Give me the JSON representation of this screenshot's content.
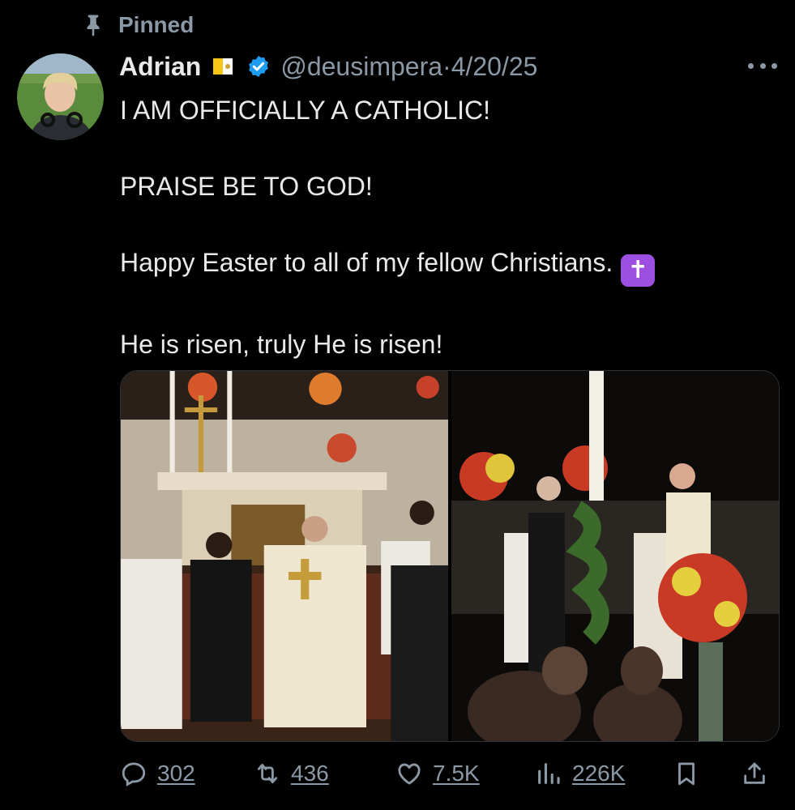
{
  "pinned": {
    "label": "Pinned"
  },
  "author": {
    "name": "Adrian",
    "handle": "@deusimpera",
    "separator": "·",
    "date": "4/20/25",
    "flag_icon": "vatican-flag-icon",
    "verified_icon": "verified-badge-icon",
    "verified_color": "#1d9bf0"
  },
  "tweet": {
    "paragraphs": [
      "I AM OFFICIALLY A CATHOLIC!",
      "PRAISE BE TO GOD!",
      "Happy Easter to all of my fellow Christians.",
      "He is risen, truly He is risen!"
    ],
    "emoji": "✝",
    "emoji_color": "#9c4fe0"
  },
  "media": [
    {
      "icon": "photo-altar-kneeling"
    },
    {
      "icon": "photo-paschal-candle"
    }
  ],
  "actions": {
    "reply": "302",
    "repost": "436",
    "like": "7.5K",
    "views": "226K"
  },
  "colors": {
    "background": "#000000",
    "text": "#e7e9ea",
    "muted": "#8b98a5"
  }
}
